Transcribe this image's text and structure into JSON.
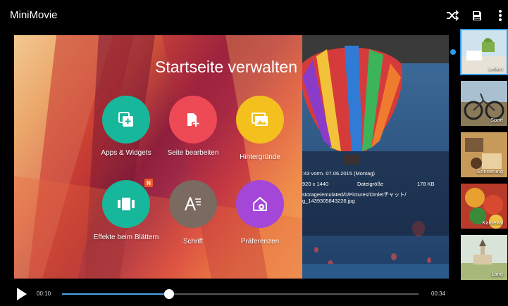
{
  "app": {
    "title": "MiniMovie"
  },
  "toolbar": {
    "icons": [
      "shuffle-icon",
      "save-icon",
      "more-vert-icon"
    ]
  },
  "overlay": {
    "title": "Startseite verwalten",
    "tiles": [
      {
        "label": "Apps & Widgets",
        "icon": "apps-widgets-icon",
        "color": "#16b79a"
      },
      {
        "label": "Seite bearbeiten",
        "icon": "edit-page-icon",
        "color": "#ee4a55"
      },
      {
        "label": "Hintergründe",
        "icon": "wallpaper-icon",
        "color": "#f4c01e"
      },
      {
        "label": "Effekte beim Blättern",
        "icon": "scroll-effects-icon",
        "color": "#16b79a",
        "badge": "N"
      },
      {
        "label": "Schrift",
        "icon": "font-icon",
        "color": "#7a6a5f"
      },
      {
        "label": "Präferenzen",
        "icon": "preferences-icon",
        "color": "#a446d8"
      }
    ]
  },
  "photo_info": {
    "line1": ":43 vorm. 07.06.2015 (Montag)",
    "line2_left": "920 x 1440",
    "line2_mid": "Dateigröße",
    "line2_right": "178 KB",
    "line3": "storage/emulated/0/Pictures/Omletチャット/",
    "line4": "g_1439305843226.jpg"
  },
  "themes": [
    {
      "label": "Leben",
      "selected": true
    },
    {
      "label": "Sport",
      "selected": false
    },
    {
      "label": "Erinnerung",
      "selected": false
    },
    {
      "label": "Karneval",
      "selected": false
    },
    {
      "label": "Land",
      "selected": false
    }
  ],
  "player": {
    "current_time": "00:10",
    "total_time": "00:34",
    "progress": 0.3
  }
}
